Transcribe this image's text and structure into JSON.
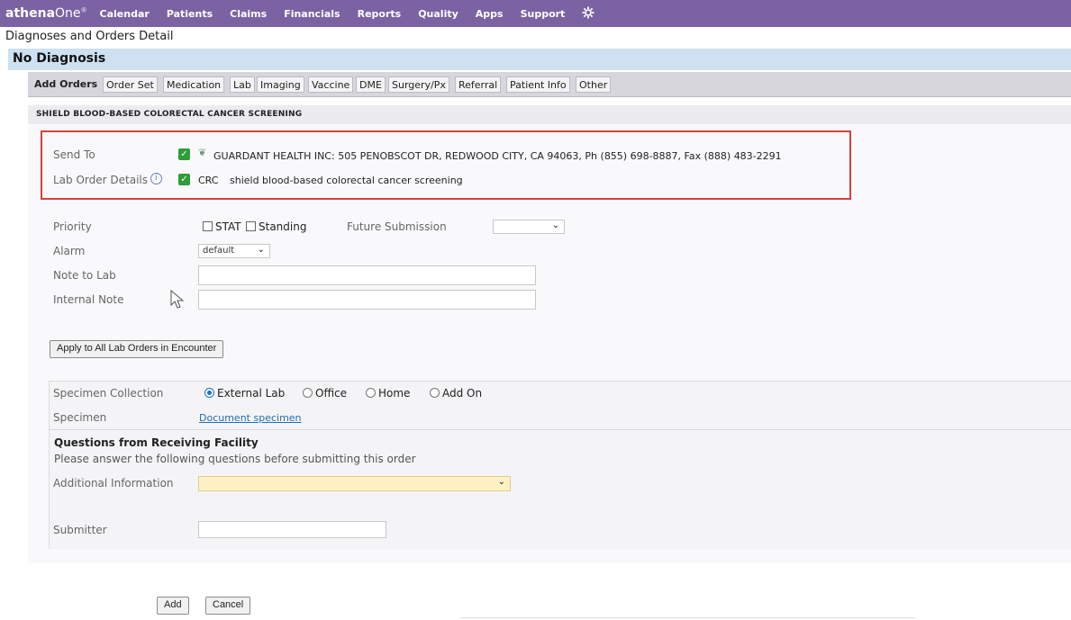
{
  "nav": {
    "brand_bold": "athena",
    "brand_rest": "One",
    "brand_mark": "®",
    "items": [
      "Calendar",
      "Patients",
      "Claims",
      "Financials",
      "Reports",
      "Quality",
      "Apps",
      "Support"
    ],
    "settings_icon": "gear-icon"
  },
  "page_title": "Diagnoses and Orders Detail",
  "diagnosis_label": "No Diagnosis",
  "tabs": {
    "active": "Add Orders",
    "items": [
      "Order Set",
      "Medication",
      "Lab",
      "Imaging",
      "Vaccine",
      "DME",
      "Surgery/Px",
      "Referral",
      "Patient Info",
      "Other"
    ]
  },
  "order_title": "SHIELD BLOOD-BASED COLORECTAL CANCER SCREENING",
  "send_to": {
    "label": "Send To",
    "value": "GUARDANT HEALTH INC: 505 PENOBSCOT DR, REDWOOD CITY, CA 94063, Ph (855) 698-8887, Fax (888) 483-2291",
    "checked": true
  },
  "lab_order_details": {
    "label": "Lab Order Details",
    "code": "CRC",
    "description": "shield blood-based colorectal cancer screening",
    "checked": true
  },
  "priority": {
    "label": "Priority",
    "options": [
      "STAT",
      "Standing"
    ],
    "future_label": "Future Submission",
    "future_value": ""
  },
  "alarm": {
    "label": "Alarm",
    "value": "default"
  },
  "note_to_lab": {
    "label": "Note to Lab",
    "value": ""
  },
  "internal_note": {
    "label": "Internal Note",
    "value": ""
  },
  "apply_button": "Apply to All Lab Orders in Encounter",
  "specimen_collection": {
    "label": "Specimen Collection",
    "options": [
      "External Lab",
      "Office",
      "Home",
      "Add On"
    ],
    "selected": "External Lab"
  },
  "specimen": {
    "label": "Specimen",
    "link": "Document specimen"
  },
  "questions": {
    "heading": "Questions from Receiving Facility",
    "subtext": "Please answer the following questions before submitting this order",
    "additional_label": "Additional Information",
    "additional_value": ""
  },
  "submitter": {
    "label": "Submitter",
    "value": ""
  },
  "buttons": {
    "add": "Add",
    "cancel": "Cancel"
  },
  "colors": {
    "nav": "#7b62a3",
    "diagnosis_bar": "#cde1f1",
    "highlight_border": "#d9403b",
    "check": "#2e9c38",
    "required_field": "#fdf1c4"
  }
}
